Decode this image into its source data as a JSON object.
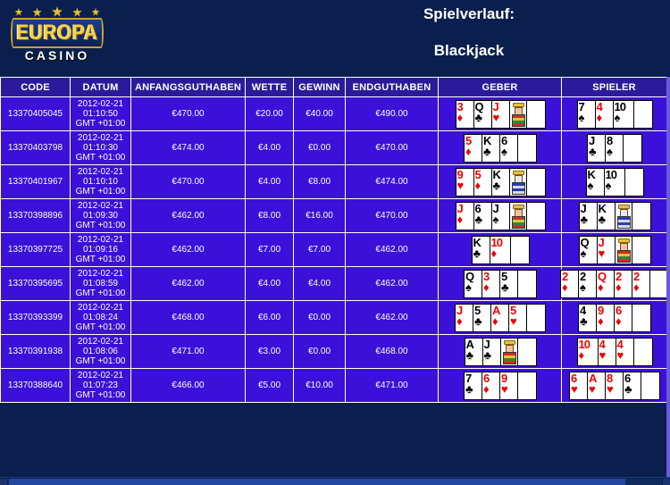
{
  "brand": {
    "name_line": "EUROPA",
    "sub_line": "CASINO",
    "stars": [
      "★",
      "★",
      "★",
      "★",
      "★"
    ],
    "colors": {
      "gold": "#f2d04b",
      "banner_blue": "#1c3c8c",
      "page_bg": "#0a1f4d"
    }
  },
  "title": {
    "line1": "Spielverlauf:",
    "line2": "Blackjack"
  },
  "table": {
    "columns": [
      "CODE",
      "DATUM",
      "ANFANGSGUTHABEN",
      "WETTE",
      "GEWINN",
      "ENDGUTHABEN",
      "GEBER",
      "SPIELER"
    ],
    "colors": {
      "header_bg": "#2b1b9c",
      "row_bg": "#3b10d8",
      "grid": "#ffffff",
      "text": "#ffffff"
    },
    "rows": [
      {
        "code": "13370405045",
        "date": "2012-02-21",
        "time": "01:10:50",
        "tz": "GMT +01:00",
        "start_balance": "€470.00",
        "bet": "€20.00",
        "win": "€40.00",
        "end_balance": "€490.00",
        "dealer": [
          {
            "rank": "3",
            "suit": "♦",
            "color": "red"
          },
          {
            "rank": "Q",
            "suit": "♣",
            "color": "black"
          },
          {
            "rank": "J",
            "suit": "♥",
            "color": "red",
            "face": "jack"
          }
        ],
        "player": [
          {
            "rank": "7",
            "suit": "♠",
            "color": "black"
          },
          {
            "rank": "4",
            "suit": "♦",
            "color": "red"
          },
          {
            "rank": "10",
            "suit": "♠",
            "color": "black"
          }
        ]
      },
      {
        "code": "13370403798",
        "date": "2012-02-21",
        "time": "01:10:30",
        "tz": "GMT +01:00",
        "start_balance": "€474.00",
        "bet": "€4.00",
        "win": "€0.00",
        "end_balance": "€470.00",
        "dealer": [
          {
            "rank": "5",
            "suit": "♦",
            "color": "red"
          },
          {
            "rank": "K",
            "suit": "♣",
            "color": "black"
          },
          {
            "rank": "6",
            "suit": "♠",
            "color": "black"
          }
        ],
        "player": [
          {
            "rank": "J",
            "suit": "♣",
            "color": "black"
          },
          {
            "rank": "8",
            "suit": "♠",
            "color": "black"
          }
        ]
      },
      {
        "code": "13370401967",
        "date": "2012-02-21",
        "time": "01:10:10",
        "tz": "GMT +01:00",
        "start_balance": "€470.00",
        "bet": "€4.00",
        "win": "€8.00",
        "end_balance": "€474.00",
        "dealer": [
          {
            "rank": "9",
            "suit": "♥",
            "color": "red"
          },
          {
            "rank": "5",
            "suit": "♦",
            "color": "red"
          },
          {
            "rank": "K",
            "suit": "♣",
            "color": "black",
            "face": "king"
          }
        ],
        "player": [
          {
            "rank": "K",
            "suit": "♠",
            "color": "black"
          },
          {
            "rank": "10",
            "suit": "♠",
            "color": "black"
          }
        ]
      },
      {
        "code": "13370398896",
        "date": "2012-02-21",
        "time": "01:09:30",
        "tz": "GMT +01:00",
        "start_balance": "€462.00",
        "bet": "€8.00",
        "win": "€16.00",
        "end_balance": "€470.00",
        "dealer": [
          {
            "rank": "J",
            "suit": "♦",
            "color": "red"
          },
          {
            "rank": "6",
            "suit": "♣",
            "color": "black"
          },
          {
            "rank": "J",
            "suit": "♠",
            "color": "black",
            "face": "jack"
          }
        ],
        "player": [
          {
            "rank": "J",
            "suit": "♣",
            "color": "black"
          },
          {
            "rank": "K",
            "suit": "♣",
            "color": "black",
            "face": "king"
          }
        ]
      },
      {
        "code": "13370397725",
        "date": "2012-02-21",
        "time": "01:09:16",
        "tz": "GMT +01:00",
        "start_balance": "€462.00",
        "bet": "€7.00",
        "win": "€7.00",
        "end_balance": "€462.00",
        "dealer": [
          {
            "rank": "K",
            "suit": "♣",
            "color": "black"
          },
          {
            "rank": "10",
            "suit": "♦",
            "color": "red"
          }
        ],
        "player": [
          {
            "rank": "Q",
            "suit": "♠",
            "color": "black"
          },
          {
            "rank": "J",
            "suit": "♥",
            "color": "red",
            "face": "jack"
          }
        ]
      },
      {
        "code": "13370395695",
        "date": "2012-02-21",
        "time": "01:08:59",
        "tz": "GMT +01:00",
        "start_balance": "€462.00",
        "bet": "€4.00",
        "win": "€4.00",
        "end_balance": "€462.00",
        "dealer": [
          {
            "rank": "Q",
            "suit": "♠",
            "color": "black"
          },
          {
            "rank": "3",
            "suit": "♦",
            "color": "red"
          },
          {
            "rank": "5",
            "suit": "♣",
            "color": "black"
          }
        ],
        "player": [
          {
            "rank": "2",
            "suit": "♦",
            "color": "red"
          },
          {
            "rank": "2",
            "suit": "♠",
            "color": "black"
          },
          {
            "rank": "Q",
            "suit": "♦",
            "color": "red"
          },
          {
            "rank": "2",
            "suit": "♦",
            "color": "red"
          },
          {
            "rank": "2",
            "suit": "♦",
            "color": "red"
          }
        ]
      },
      {
        "code": "13370393399",
        "date": "2012-02-21",
        "time": "01:08:24",
        "tz": "GMT +01:00",
        "start_balance": "€468.00",
        "bet": "€6.00",
        "win": "€0.00",
        "end_balance": "€462.00",
        "dealer": [
          {
            "rank": "J",
            "suit": "♦",
            "color": "red"
          },
          {
            "rank": "5",
            "suit": "♣",
            "color": "black"
          },
          {
            "rank": "A",
            "suit": "♦",
            "color": "red"
          },
          {
            "rank": "5",
            "suit": "♥",
            "color": "red"
          }
        ],
        "player": [
          {
            "rank": "4",
            "suit": "♣",
            "color": "black"
          },
          {
            "rank": "9",
            "suit": "♦",
            "color": "red"
          },
          {
            "rank": "6",
            "suit": "♦",
            "color": "red"
          }
        ]
      },
      {
        "code": "13370391938",
        "date": "2012-02-21",
        "time": "01:08:06",
        "tz": "GMT +01:00",
        "start_balance": "€471.00",
        "bet": "€3.00",
        "win": "€0.00",
        "end_balance": "€468.00",
        "dealer": [
          {
            "rank": "A",
            "suit": "♣",
            "color": "black"
          },
          {
            "rank": "J",
            "suit": "♣",
            "color": "black",
            "face": "jack"
          }
        ],
        "player": [
          {
            "rank": "10",
            "suit": "♦",
            "color": "red"
          },
          {
            "rank": "4",
            "suit": "♥",
            "color": "red"
          },
          {
            "rank": "4",
            "suit": "♥",
            "color": "red"
          }
        ]
      },
      {
        "code": "13370388640",
        "date": "2012-02-21",
        "time": "01:07:23",
        "tz": "GMT +01:00",
        "start_balance": "€466.00",
        "bet": "€5.00",
        "win": "€10.00",
        "end_balance": "€471.00",
        "dealer": [
          {
            "rank": "7",
            "suit": "♣",
            "color": "black"
          },
          {
            "rank": "6",
            "suit": "♦",
            "color": "red"
          },
          {
            "rank": "9",
            "suit": "♥",
            "color": "red"
          }
        ],
        "player": [
          {
            "rank": "6",
            "suit": "♥",
            "color": "red"
          },
          {
            "rank": "A",
            "suit": "♥",
            "color": "red"
          },
          {
            "rank": "8",
            "suit": "♥",
            "color": "red"
          },
          {
            "rank": "6",
            "suit": "♣",
            "color": "black"
          }
        ]
      }
    ]
  },
  "scrollbars": {
    "horizontal_visible": true,
    "vertical_visible": true
  }
}
